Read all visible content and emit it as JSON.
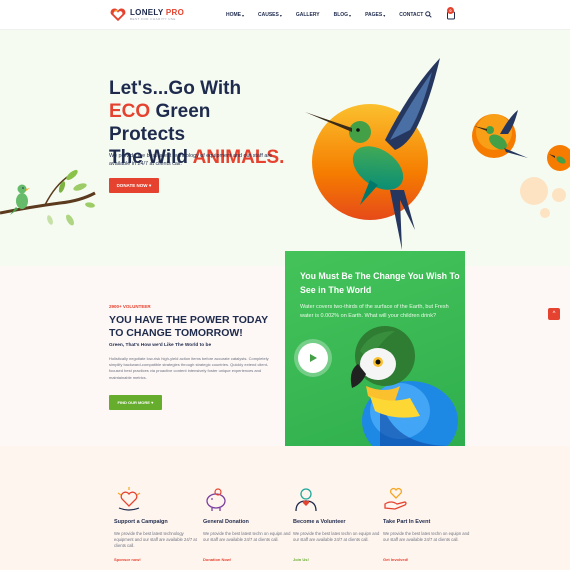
{
  "brand": {
    "name_part1": "LONELY",
    "name_part2": " PRO",
    "tagline": "BEST FOR CHARITY USE"
  },
  "nav": {
    "items": [
      {
        "label": "HOME",
        "dropdown": true
      },
      {
        "label": "CAUSES",
        "dropdown": true
      },
      {
        "label": "GALLERY",
        "dropdown": false
      },
      {
        "label": "BLOG",
        "dropdown": true
      },
      {
        "label": "PAGES",
        "dropdown": true
      },
      {
        "label": "CONTACT",
        "dropdown": false
      }
    ],
    "cart_count": "0",
    "icons": [
      "search-icon",
      "cart-icon"
    ]
  },
  "hero": {
    "line1": "Let's...Go With",
    "line2_accent": "ECO",
    "line2_rest": " Green Protects",
    "line3_start": "The Wild ",
    "line3_accent": "ANIMALS.",
    "description": "We provide the best latest technology of equipment and our staff are available in 24/7 at clients call.",
    "button_label": "DONATE NOW"
  },
  "volunteer": {
    "tag": "2900+ VOLUNTEER",
    "title": "YOU HAVE THE POWER TODAY TO CHANGE TOMORROW!",
    "subtitle": "Green, That's How we'd Like The World to be",
    "description": "Holistically negotiate low-risk high-yield action items before accurate catalysts. Completely simplify backward-compatible strategies through strategic countries. Quickly extend client-focused best practices via proactive content intensively foster unique experiences and maintainable metrics.",
    "button_label": "FIND OUR MORE"
  },
  "green_card": {
    "title": "You Must Be The Change You Wish To See in The World",
    "description": "Water covers two-thirds of the surface of the Earth, but Fresh water is 0.002% on Earth. What will your children drink?"
  },
  "features": [
    {
      "title": "Support a Campaign",
      "desc": "We provide the best latest technology equipment and our staff are available 24/7 at clients call.",
      "link": "Sponsor now!",
      "icon": "campaign-heart-icon"
    },
    {
      "title": "General Donation",
      "desc": "We provide the best latest techn on equipn and our staff are available 24/7 at clients call.",
      "link": "Donation Now!",
      "icon": "piggy-bank-icon"
    },
    {
      "title": "Become a Volunteer",
      "desc": "We provide the best lates techn on equipn and our staff are available 24/7 at clients call.",
      "link": "Join Us!",
      "icon": "volunteer-icon"
    },
    {
      "title": "Take Part In Event",
      "desc": "We provide the best lates techn on equipn and our staff are available 24/7 at clients call.",
      "link": "Get Involved!",
      "icon": "hand-heart-icon"
    }
  ],
  "colors": {
    "accent_red": "#e5432f",
    "accent_green": "#66ad2e",
    "navy": "#1f2b4d",
    "card_green": "#3bb854"
  }
}
